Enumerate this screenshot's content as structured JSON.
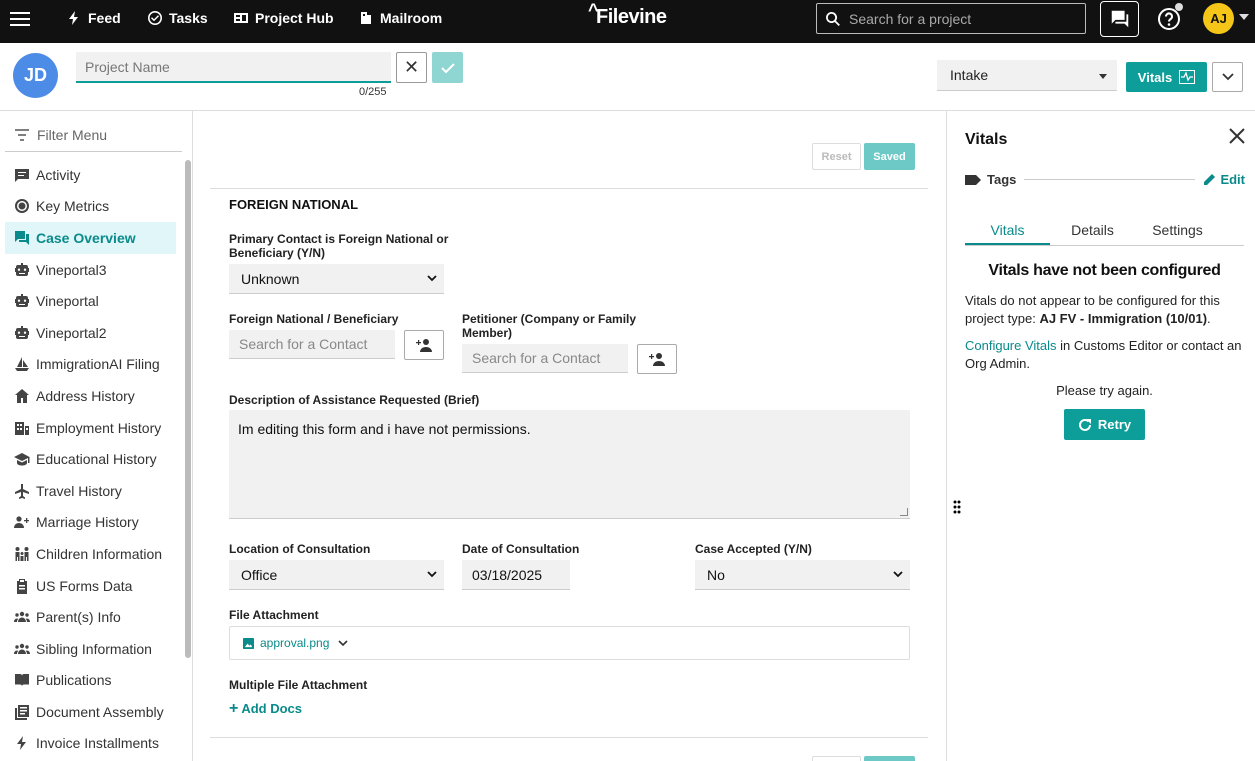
{
  "topbar": {
    "nav": [
      {
        "label": "Feed",
        "icon": "bolt-icon"
      },
      {
        "label": "Tasks",
        "icon": "check-circle-icon"
      },
      {
        "label": "Project Hub",
        "icon": "hub-icon"
      },
      {
        "label": "Mailroom",
        "icon": "mailroom-icon"
      }
    ],
    "logo": "Filevine",
    "search_placeholder": "Search for a project",
    "user_initials": "AJ"
  },
  "header": {
    "avatar_initials": "JD",
    "project_name_placeholder": "Project Name",
    "char_counter": "0/255",
    "phase": "Intake",
    "vitals_button": "Vitals"
  },
  "sidebar": {
    "filter_placeholder": "Filter Menu",
    "items": [
      {
        "label": "Activity",
        "icon": "comment-icon"
      },
      {
        "label": "Key Metrics",
        "icon": "target-icon"
      },
      {
        "label": "Case Overview",
        "icon": "chat-icon",
        "active": true
      },
      {
        "label": "Vineportal3",
        "icon": "robot-icon"
      },
      {
        "label": "Vineportal",
        "icon": "robot-icon"
      },
      {
        "label": "Vineportal2",
        "icon": "robot-icon"
      },
      {
        "label": "ImmigrationAI Filing",
        "icon": "sailboat-icon"
      },
      {
        "label": "Address History",
        "icon": "home-icon"
      },
      {
        "label": "Employment History",
        "icon": "building-icon"
      },
      {
        "label": "Educational History",
        "icon": "graduation-cap-icon"
      },
      {
        "label": "Travel History",
        "icon": "airplane-icon"
      },
      {
        "label": "Marriage History",
        "icon": "people-plus-icon"
      },
      {
        "label": "Children Information",
        "icon": "family-icon"
      },
      {
        "label": "US Forms Data",
        "icon": "clipboard-icon"
      },
      {
        "label": "Parent(s) Info",
        "icon": "group-icon"
      },
      {
        "label": "Sibling Information",
        "icon": "group-icon"
      },
      {
        "label": "Publications",
        "icon": "book-icon"
      },
      {
        "label": "Document Assembly",
        "icon": "documents-icon"
      },
      {
        "label": "Invoice Installments",
        "icon": "bolt-icon"
      }
    ]
  },
  "form": {
    "reset_label": "Reset",
    "saved_label": "Saved",
    "section_title": "FOREIGN NATIONAL",
    "primary_contact_label": "Primary Contact is Foreign National or Beneficiary (Y/N)",
    "primary_contact_value": "Unknown",
    "foreign_national_label": "Foreign National / Beneficiary",
    "foreign_national_placeholder": "Search for a Contact",
    "petitioner_label": "Petitioner (Company or Family Member)",
    "petitioner_placeholder": "Search for a Contact",
    "description_label": "Description of Assistance Requested (Brief)",
    "description_value": "Im editing this form and i have not permissions.",
    "location_label": "Location of Consultation",
    "location_value": "Office",
    "date_label": "Date of Consultation",
    "date_value": "03/18/2025",
    "case_accepted_label": "Case Accepted (Y/N)",
    "case_accepted_value": "No",
    "file_attachment_label": "File Attachment",
    "file_name": "approval.png",
    "multiple_file_label": "Multiple File Attachment",
    "add_docs_label": "Add Docs"
  },
  "vitals_panel": {
    "title": "Vitals",
    "tags_label": "Tags",
    "edit_label": "Edit",
    "tabs": [
      "Vitals",
      "Details",
      "Settings"
    ],
    "heading": "Vitals have not been configured",
    "message_prefix": "Vitals do not appear to be configured for this project type: ",
    "project_type": "AJ FV - Immigration (10/01)",
    "message_suffix": ".",
    "configure_link": "Configure Vitals",
    "configure_suffix": " in Customs Editor or contact an Org Admin.",
    "try_again": "Please try again.",
    "retry_label": "Retry"
  },
  "colors": {
    "accent": "#0e9e9a",
    "topbar_bg": "#111111",
    "avatar_top": "#f5c518",
    "avatar_jd": "#4d8ce6"
  }
}
